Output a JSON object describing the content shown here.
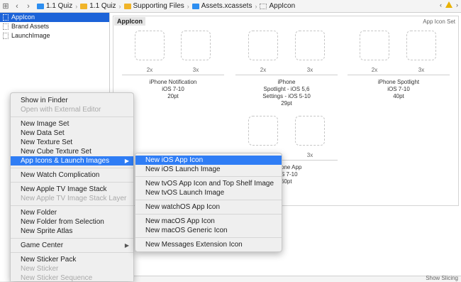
{
  "jumpbar": {
    "crumbs": [
      {
        "label": "1.1 Quiz",
        "icon": "blue-project-icon"
      },
      {
        "label": "1.1 Quiz",
        "icon": "folder-icon"
      },
      {
        "label": "Supporting Files",
        "icon": "folder-icon"
      },
      {
        "label": "Assets.xcassets",
        "icon": "asset-catalog-icon"
      },
      {
        "label": "AppIcon",
        "icon": "image-set-icon"
      }
    ],
    "colors": {
      "folder": "#f0b429",
      "catalog": "#2d8ef0",
      "selection": "#1c63d8",
      "menu_highlight": "#2f7df5"
    }
  },
  "sidebar": {
    "items": [
      {
        "label": "AppIcon",
        "selected": true
      },
      {
        "label": "Brand Assets",
        "selected": false
      },
      {
        "label": "LaunchImage",
        "selected": false
      }
    ]
  },
  "main": {
    "set_name": "AppIcon",
    "set_type": "App Icon Set",
    "scale_2x": "2x",
    "scale_3x": "3x",
    "groups": [
      "iPhone Notification\niOS 7-10\n20pt",
      "iPhone\nSpotlight - iOS 5,6\nSettings - iOS 5-10\n29pt",
      "iPhone Spotlight\niOS 7-10\n40pt",
      "one App\nS 7-10\n60pt"
    ],
    "bottom_text": "Show Slicing"
  },
  "context_menu": {
    "items": [
      {
        "label": "Show in Finder",
        "disabled": false
      },
      {
        "label": "Open with External Editor",
        "disabled": true
      },
      {
        "sep": true
      },
      {
        "label": "New Image Set",
        "disabled": false
      },
      {
        "label": "New Data Set",
        "disabled": false
      },
      {
        "label": "New Texture Set",
        "disabled": false
      },
      {
        "label": "New Cube Texture Set",
        "disabled": false
      },
      {
        "label": "App Icons & Launch Images",
        "disabled": false,
        "highlight": true,
        "submenu": true
      },
      {
        "sep": true
      },
      {
        "label": "New Watch Complication",
        "disabled": false
      },
      {
        "sep": true
      },
      {
        "label": "New Apple TV Image Stack",
        "disabled": false
      },
      {
        "label": "New Apple TV Image Stack Layer",
        "disabled": true
      },
      {
        "sep": true
      },
      {
        "label": "New Folder",
        "disabled": false
      },
      {
        "label": "New Folder from Selection",
        "disabled": false
      },
      {
        "label": "New Sprite Atlas",
        "disabled": false
      },
      {
        "sep": true
      },
      {
        "label": "Game Center",
        "disabled": false,
        "submenu": true
      },
      {
        "sep": true
      },
      {
        "label": "New Sticker Pack",
        "disabled": false
      },
      {
        "label": "New Sticker",
        "disabled": true
      },
      {
        "label": "New Sticker Sequence",
        "disabled": true
      }
    ]
  },
  "submenu": {
    "items": [
      {
        "label": "New iOS App Icon",
        "highlight": true
      },
      {
        "label": "New iOS Launch Image"
      },
      {
        "sep": true
      },
      {
        "label": "New tvOS App Icon and Top Shelf Image"
      },
      {
        "label": "New tvOS Launch Image"
      },
      {
        "sep": true
      },
      {
        "label": "New watchOS App Icon"
      },
      {
        "sep": true
      },
      {
        "label": "New macOS App Icon"
      },
      {
        "label": "New macOS Generic Icon"
      },
      {
        "sep": true
      },
      {
        "label": "New Messages Extension Icon"
      }
    ]
  }
}
